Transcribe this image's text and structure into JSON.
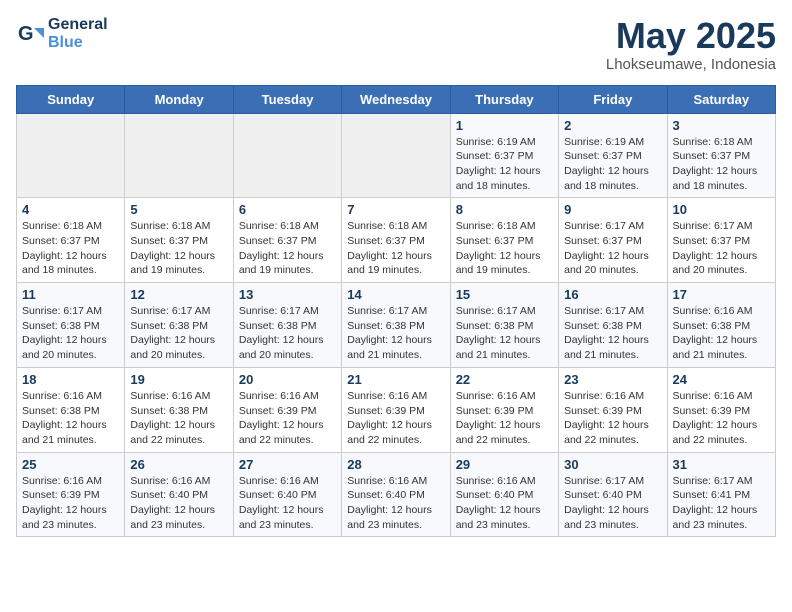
{
  "logo": {
    "line1": "General",
    "line2": "Blue"
  },
  "title": "May 2025",
  "location": "Lhokseumawe, Indonesia",
  "days_header": [
    "Sunday",
    "Monday",
    "Tuesday",
    "Wednesday",
    "Thursday",
    "Friday",
    "Saturday"
  ],
  "weeks": [
    [
      {
        "day": "",
        "info": ""
      },
      {
        "day": "",
        "info": ""
      },
      {
        "day": "",
        "info": ""
      },
      {
        "day": "",
        "info": ""
      },
      {
        "day": "1",
        "info": "Sunrise: 6:19 AM\nSunset: 6:37 PM\nDaylight: 12 hours\nand 18 minutes."
      },
      {
        "day": "2",
        "info": "Sunrise: 6:19 AM\nSunset: 6:37 PM\nDaylight: 12 hours\nand 18 minutes."
      },
      {
        "day": "3",
        "info": "Sunrise: 6:18 AM\nSunset: 6:37 PM\nDaylight: 12 hours\nand 18 minutes."
      }
    ],
    [
      {
        "day": "4",
        "info": "Sunrise: 6:18 AM\nSunset: 6:37 PM\nDaylight: 12 hours\nand 18 minutes."
      },
      {
        "day": "5",
        "info": "Sunrise: 6:18 AM\nSunset: 6:37 PM\nDaylight: 12 hours\nand 19 minutes."
      },
      {
        "day": "6",
        "info": "Sunrise: 6:18 AM\nSunset: 6:37 PM\nDaylight: 12 hours\nand 19 minutes."
      },
      {
        "day": "7",
        "info": "Sunrise: 6:18 AM\nSunset: 6:37 PM\nDaylight: 12 hours\nand 19 minutes."
      },
      {
        "day": "8",
        "info": "Sunrise: 6:18 AM\nSunset: 6:37 PM\nDaylight: 12 hours\nand 19 minutes."
      },
      {
        "day": "9",
        "info": "Sunrise: 6:17 AM\nSunset: 6:37 PM\nDaylight: 12 hours\nand 20 minutes."
      },
      {
        "day": "10",
        "info": "Sunrise: 6:17 AM\nSunset: 6:37 PM\nDaylight: 12 hours\nand 20 minutes."
      }
    ],
    [
      {
        "day": "11",
        "info": "Sunrise: 6:17 AM\nSunset: 6:38 PM\nDaylight: 12 hours\nand 20 minutes."
      },
      {
        "day": "12",
        "info": "Sunrise: 6:17 AM\nSunset: 6:38 PM\nDaylight: 12 hours\nand 20 minutes."
      },
      {
        "day": "13",
        "info": "Sunrise: 6:17 AM\nSunset: 6:38 PM\nDaylight: 12 hours\nand 20 minutes."
      },
      {
        "day": "14",
        "info": "Sunrise: 6:17 AM\nSunset: 6:38 PM\nDaylight: 12 hours\nand 21 minutes."
      },
      {
        "day": "15",
        "info": "Sunrise: 6:17 AM\nSunset: 6:38 PM\nDaylight: 12 hours\nand 21 minutes."
      },
      {
        "day": "16",
        "info": "Sunrise: 6:17 AM\nSunset: 6:38 PM\nDaylight: 12 hours\nand 21 minutes."
      },
      {
        "day": "17",
        "info": "Sunrise: 6:16 AM\nSunset: 6:38 PM\nDaylight: 12 hours\nand 21 minutes."
      }
    ],
    [
      {
        "day": "18",
        "info": "Sunrise: 6:16 AM\nSunset: 6:38 PM\nDaylight: 12 hours\nand 21 minutes."
      },
      {
        "day": "19",
        "info": "Sunrise: 6:16 AM\nSunset: 6:38 PM\nDaylight: 12 hours\nand 22 minutes."
      },
      {
        "day": "20",
        "info": "Sunrise: 6:16 AM\nSunset: 6:39 PM\nDaylight: 12 hours\nand 22 minutes."
      },
      {
        "day": "21",
        "info": "Sunrise: 6:16 AM\nSunset: 6:39 PM\nDaylight: 12 hours\nand 22 minutes."
      },
      {
        "day": "22",
        "info": "Sunrise: 6:16 AM\nSunset: 6:39 PM\nDaylight: 12 hours\nand 22 minutes."
      },
      {
        "day": "23",
        "info": "Sunrise: 6:16 AM\nSunset: 6:39 PM\nDaylight: 12 hours\nand 22 minutes."
      },
      {
        "day": "24",
        "info": "Sunrise: 6:16 AM\nSunset: 6:39 PM\nDaylight: 12 hours\nand 22 minutes."
      }
    ],
    [
      {
        "day": "25",
        "info": "Sunrise: 6:16 AM\nSunset: 6:39 PM\nDaylight: 12 hours\nand 23 minutes."
      },
      {
        "day": "26",
        "info": "Sunrise: 6:16 AM\nSunset: 6:40 PM\nDaylight: 12 hours\nand 23 minutes."
      },
      {
        "day": "27",
        "info": "Sunrise: 6:16 AM\nSunset: 6:40 PM\nDaylight: 12 hours\nand 23 minutes."
      },
      {
        "day": "28",
        "info": "Sunrise: 6:16 AM\nSunset: 6:40 PM\nDaylight: 12 hours\nand 23 minutes."
      },
      {
        "day": "29",
        "info": "Sunrise: 6:16 AM\nSunset: 6:40 PM\nDaylight: 12 hours\nand 23 minutes."
      },
      {
        "day": "30",
        "info": "Sunrise: 6:17 AM\nSunset: 6:40 PM\nDaylight: 12 hours\nand 23 minutes."
      },
      {
        "day": "31",
        "info": "Sunrise: 6:17 AM\nSunset: 6:41 PM\nDaylight: 12 hours\nand 23 minutes."
      }
    ]
  ]
}
